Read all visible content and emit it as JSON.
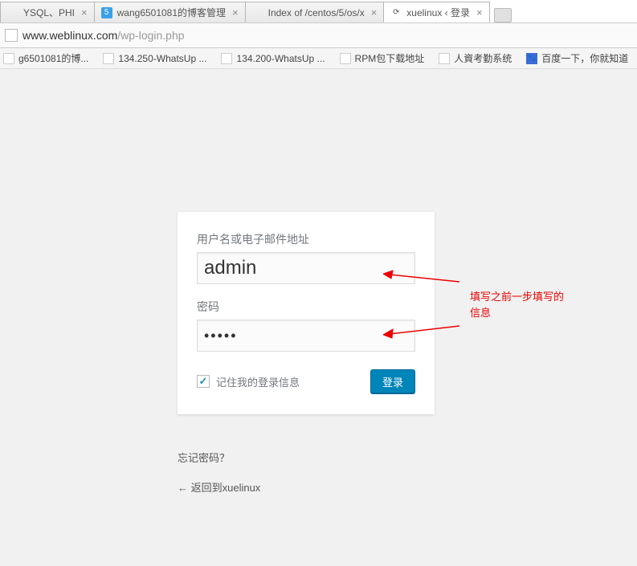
{
  "tabs": [
    {
      "title": "YSQL、PHI",
      "favicon": ""
    },
    {
      "title": "wang6501081的博客管理",
      "favicon": "5"
    },
    {
      "title": "Index of /centos/5/os/x",
      "favicon": ""
    },
    {
      "title": "xuelinux ‹ 登录",
      "favicon": "⟳"
    }
  ],
  "addressbar": {
    "host": "www.weblinux.com",
    "path": "/wp-login.php"
  },
  "bookmarks": [
    {
      "label": "g6501081的博..."
    },
    {
      "label": "134.250-WhatsUp ..."
    },
    {
      "label": "134.200-WhatsUp ..."
    },
    {
      "label": "RPM包下载地址"
    },
    {
      "label": "人資考勤系统"
    },
    {
      "label": "百度一下，你就知道",
      "paw": true
    }
  ],
  "login": {
    "username_label": "用户名或电子邮件地址",
    "username_value": "admin",
    "password_label": "密码",
    "password_value": "•••••",
    "remember_label": "记住我的登录信息",
    "submit_label": "登录"
  },
  "links": {
    "forgot": "忘记密码？",
    "back": "← 返回到xuelinux"
  },
  "annotation": {
    "text": "填写之前一步填写的\n信息"
  }
}
